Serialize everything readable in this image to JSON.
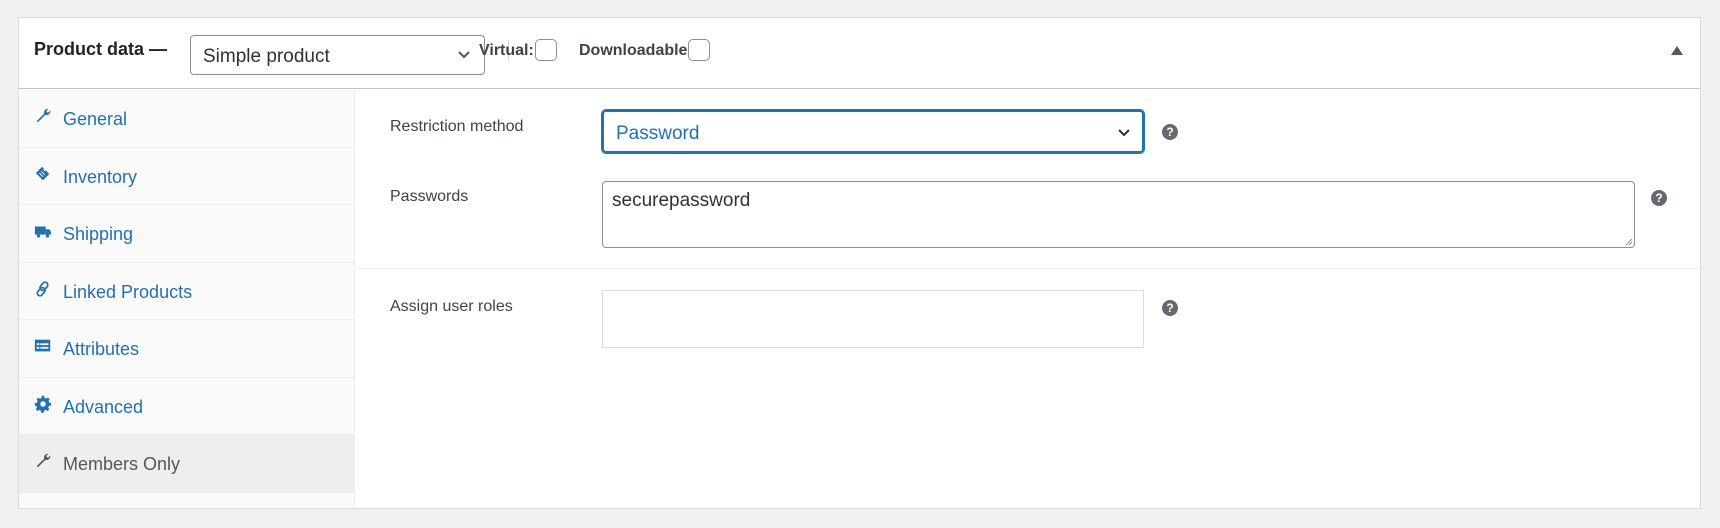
{
  "header": {
    "title": "Product data —",
    "product_type": {
      "selected": "Simple product",
      "icon": "chevron-down-icon"
    },
    "virtual_label": "Virtual:",
    "virtual_checked": false,
    "downloadable_label": "Downloadable:",
    "downloadable_checked": false,
    "collapse_icon": "triangle-up-icon"
  },
  "sidebar": {
    "items": [
      {
        "label": "General",
        "icon": "wrench-icon",
        "active": false
      },
      {
        "label": "Inventory",
        "icon": "clipboard-tag-icon",
        "active": false
      },
      {
        "label": "Shipping",
        "icon": "truck-icon",
        "active": false
      },
      {
        "label": "Linked Products",
        "icon": "link-icon",
        "active": false
      },
      {
        "label": "Attributes",
        "icon": "list-card-icon",
        "active": false
      },
      {
        "label": "Advanced",
        "icon": "gear-icon",
        "active": false
      },
      {
        "label": "Members Only",
        "icon": "wrench-icon",
        "active": true
      }
    ]
  },
  "main": {
    "restriction_method": {
      "label": "Restriction method",
      "selected": "Password",
      "help_icon": "help-icon"
    },
    "passwords": {
      "label": "Passwords",
      "value": "securepassword",
      "help_icon": "help-icon"
    },
    "user_roles": {
      "label": "Assign user roles",
      "value": "",
      "help_icon": "help-icon"
    }
  },
  "colors": {
    "link": "#2271b1",
    "active_tab_bg": "#eeeeee",
    "focus_border": "#2271b1",
    "background": "#f0f0f1"
  }
}
